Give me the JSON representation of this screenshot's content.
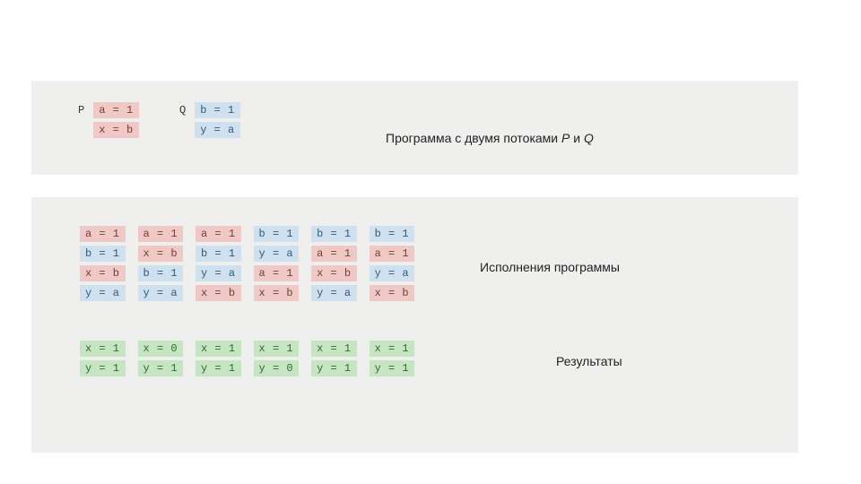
{
  "colors": {
    "red": "#eec9c6",
    "blue": "#cfe1ef",
    "green": "#c6e6c3"
  },
  "top": {
    "threadP": {
      "label": "P",
      "lines": [
        {
          "text": "a = 1",
          "c": "red"
        },
        {
          "text": "x = b",
          "c": "red"
        }
      ]
    },
    "threadQ": {
      "label": "Q",
      "lines": [
        {
          "text": "b = 1",
          "c": "blue"
        },
        {
          "text": "y = a",
          "c": "blue"
        }
      ]
    },
    "caption_prefix": "Программа с двумя потоками ",
    "caption_P": "P",
    "caption_mid": " и ",
    "caption_Q": "Q"
  },
  "executions": {
    "caption": "Исполнения программы",
    "cols": [
      [
        {
          "t": "a = 1",
          "c": "red"
        },
        {
          "t": "b = 1",
          "c": "blue"
        },
        {
          "t": "x = b",
          "c": "red"
        },
        {
          "t": "y = a",
          "c": "blue"
        }
      ],
      [
        {
          "t": "a = 1",
          "c": "red"
        },
        {
          "t": "x = b",
          "c": "red"
        },
        {
          "t": "b = 1",
          "c": "blue"
        },
        {
          "t": "y = a",
          "c": "blue"
        }
      ],
      [
        {
          "t": "a = 1",
          "c": "red"
        },
        {
          "t": "b = 1",
          "c": "blue"
        },
        {
          "t": "y = a",
          "c": "blue"
        },
        {
          "t": "x = b",
          "c": "red"
        }
      ],
      [
        {
          "t": "b = 1",
          "c": "blue"
        },
        {
          "t": "y = a",
          "c": "blue"
        },
        {
          "t": "a = 1",
          "c": "red"
        },
        {
          "t": "x = b",
          "c": "red"
        }
      ],
      [
        {
          "t": "b = 1",
          "c": "blue"
        },
        {
          "t": "a = 1",
          "c": "red"
        },
        {
          "t": "x = b",
          "c": "red"
        },
        {
          "t": "y = a",
          "c": "blue"
        }
      ],
      [
        {
          "t": "b = 1",
          "c": "blue"
        },
        {
          "t": "a = 1",
          "c": "red"
        },
        {
          "t": "y = a",
          "c": "blue"
        },
        {
          "t": "x = b",
          "c": "red"
        }
      ]
    ]
  },
  "results": {
    "caption": "Результаты",
    "cols": [
      [
        {
          "t": "x = 1",
          "c": "green"
        },
        {
          "t": "y = 1",
          "c": "green"
        }
      ],
      [
        {
          "t": "x = 0",
          "c": "green"
        },
        {
          "t": "y = 1",
          "c": "green"
        }
      ],
      [
        {
          "t": "x = 1",
          "c": "green"
        },
        {
          "t": "y = 1",
          "c": "green"
        }
      ],
      [
        {
          "t": "x = 1",
          "c": "green"
        },
        {
          "t": "y = 0",
          "c": "green"
        }
      ],
      [
        {
          "t": "x = 1",
          "c": "green"
        },
        {
          "t": "y = 1",
          "c": "green"
        }
      ],
      [
        {
          "t": "x = 1",
          "c": "green"
        },
        {
          "t": "y = 1",
          "c": "green"
        }
      ]
    ]
  }
}
